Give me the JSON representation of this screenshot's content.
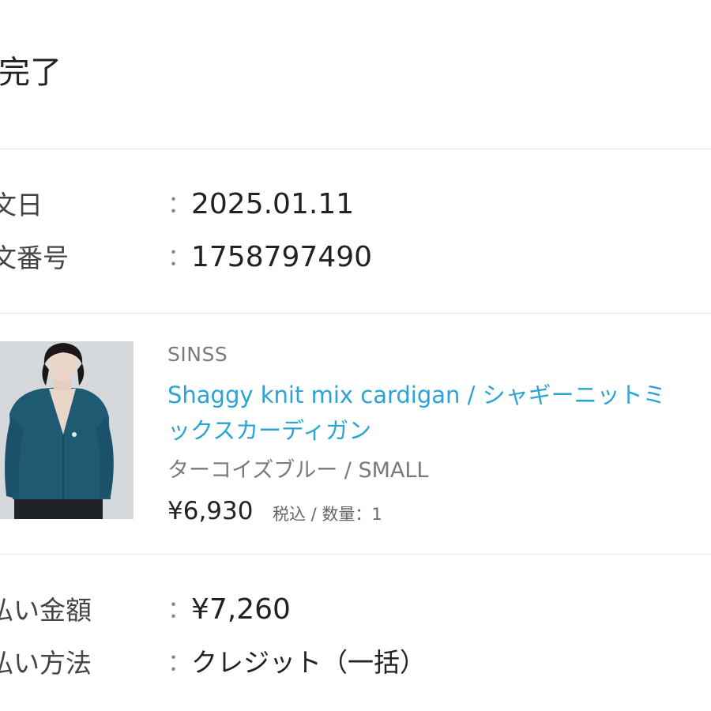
{
  "header": {
    "title": "達完了"
  },
  "order": {
    "date_label": "文日",
    "date_value": "2025.01.11",
    "number_label": "文番号",
    "number_value": "1758797490",
    "colon": "："
  },
  "item": {
    "brand": "SINSS",
    "name_line1": "Shaggy knit mix cardigan / シャギーニットミ",
    "name_line2": "ックスカーディガン",
    "variant": "ターコイズブルー / SMALL",
    "price": "¥6,930",
    "price_note": "税込 / 数量：1"
  },
  "payment": {
    "amount_label": "払い金額",
    "amount_value": "¥7,260",
    "method_label": "払い方法",
    "method_value": "クレジット（一括）"
  },
  "colors": {
    "link": "#2aa3d5",
    "divider": "#e6e6e6",
    "cardigan": "#1f5a73",
    "photo_bg": "#d9dcdf"
  }
}
